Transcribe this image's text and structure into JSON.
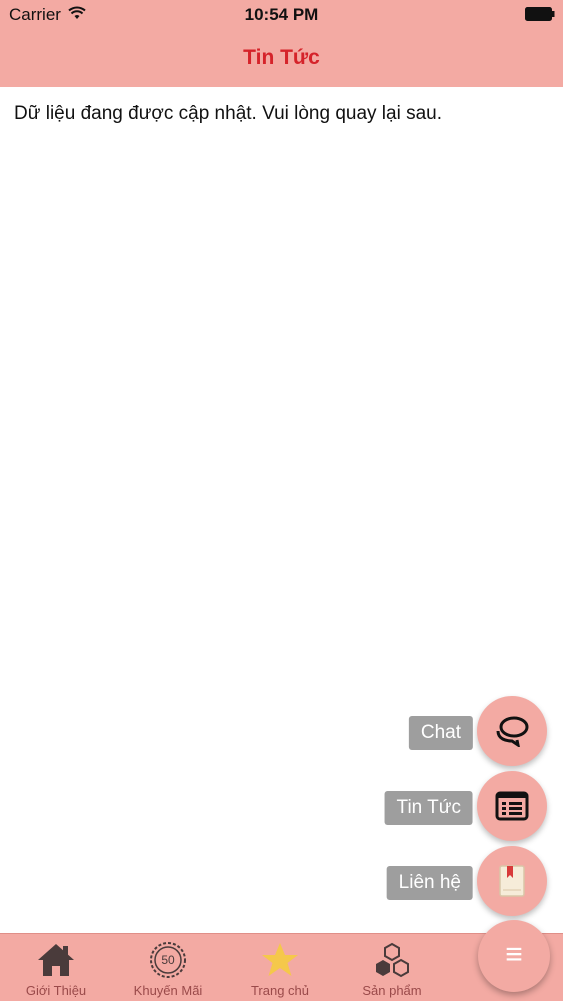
{
  "status_bar": {
    "carrier": "Carrier",
    "time": "10:54 PM"
  },
  "nav": {
    "title": "Tin Tức"
  },
  "content": {
    "message": "Dữ liệu đang được cập nhật. Vui lòng quay lại sau."
  },
  "fab_menu": {
    "items": [
      {
        "label": "Chat",
        "icon": "chat-icon"
      },
      {
        "label": "Tin Tức",
        "icon": "news-list-icon"
      },
      {
        "label": "Liên hệ",
        "icon": "bookmark-book-icon"
      }
    ],
    "main_icon": "menu-icon",
    "main_glyph": "≡"
  },
  "tab_bar": {
    "items": [
      {
        "label": "Giới Thiệu",
        "icon": "home-icon"
      },
      {
        "label": "Khuyến Mãi",
        "icon": "discount-badge-icon",
        "badge_text": "50"
      },
      {
        "label": "Trang chủ",
        "icon": "star-icon"
      },
      {
        "label": "Sản phẩm",
        "icon": "boxes-icon"
      }
    ]
  },
  "colors": {
    "bar_background": "#f3aaa3",
    "title_red": "#d5232a",
    "label_gray": "#9e9e9e",
    "star_yellow": "#f5c84a"
  }
}
